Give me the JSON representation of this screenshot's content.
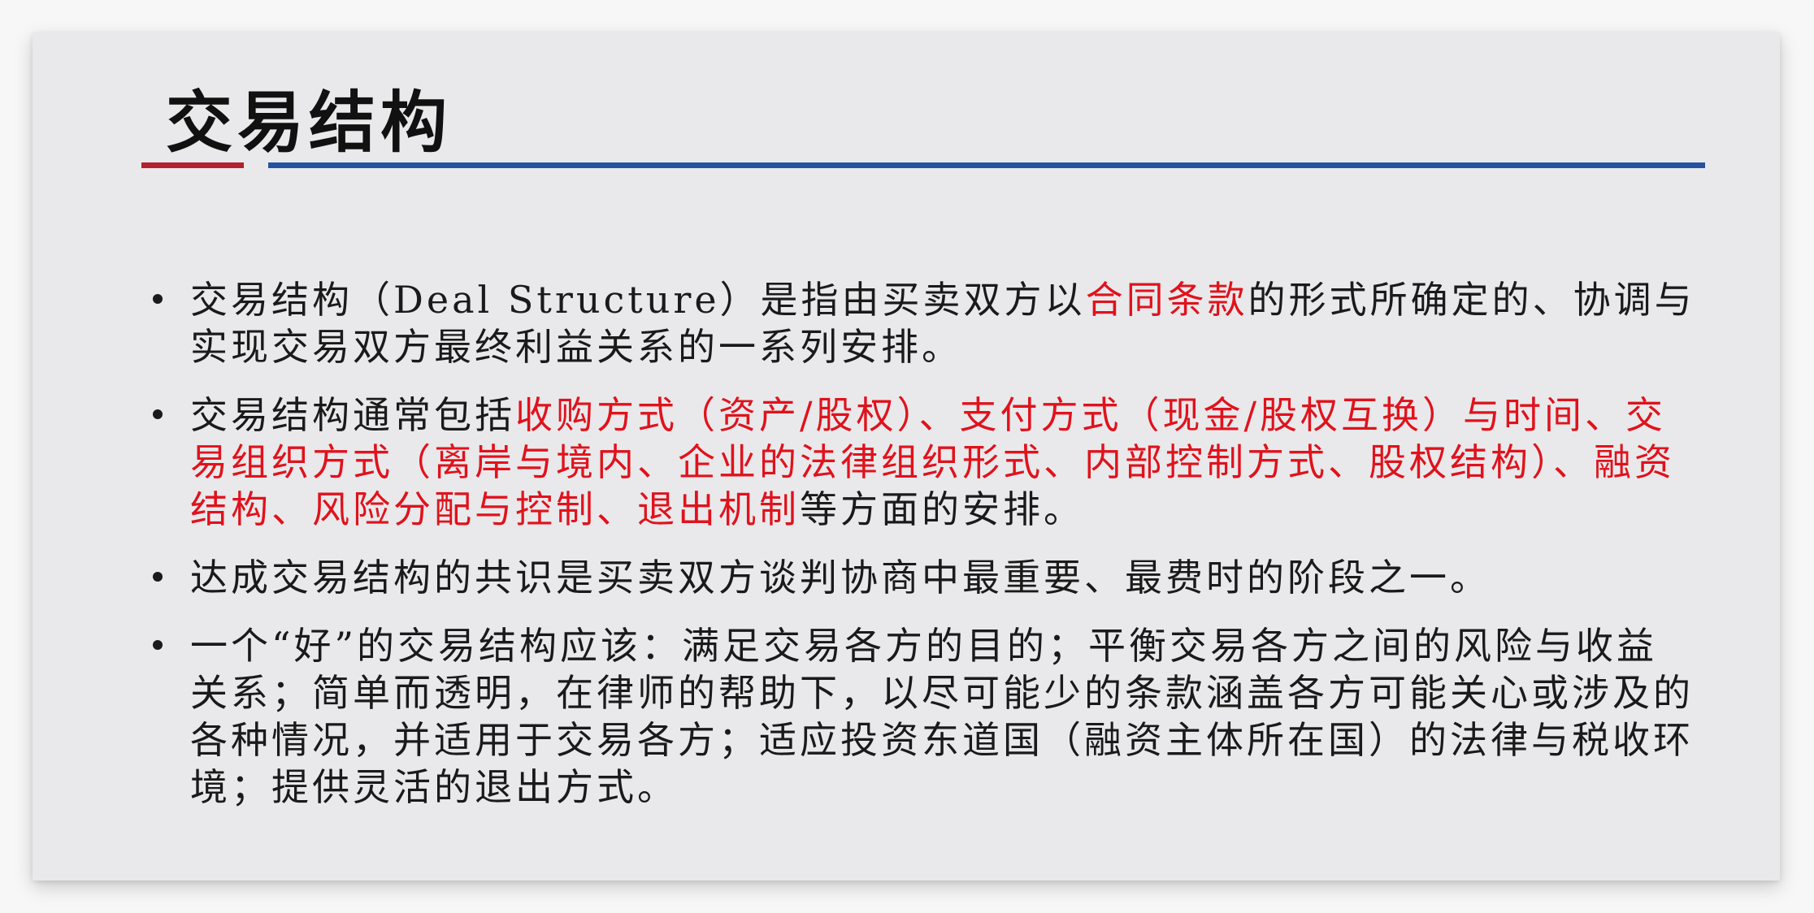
{
  "slide": {
    "title": "交易结构",
    "accent_colors": {
      "title_rule_left": "#b4202d",
      "title_rule_right": "#2652a0",
      "highlight_text": "#e0121c"
    },
    "bullets": [
      {
        "pre": "交易结构（Deal Structure）是指由买卖双方以",
        "highlight": "合同条款",
        "post": "的形式所确定的、协调与实现交易双方最终利益关系的一系列安排。"
      },
      {
        "pre": "交易结构通常包括",
        "highlight": "收购方式（资产/股权）、支付方式（现金/股权互换）与时间、交易组织方式（离岸与境内、企业的法律组织形式、内部控制方式、股权结构）、融资结构、风险分配与控制、退出机制",
        "post": "等方面的安排。"
      },
      {
        "pre": "达成交易结构的共识是买卖双方谈判协商中最重要、最费时的阶段之一。",
        "highlight": "",
        "post": ""
      },
      {
        "pre": "一个“好”的交易结构应该：满足交易各方的目的；平衡交易各方之间的风险与收益关系；简单而透明，在律师的帮助下，以尽可能少的条款涵盖各方可能关心或涉及的各种情况，并适用于交易各方；适应投资东道国（融资主体所在国）的法律与税收环境；提供灵活的退出方式。",
        "highlight": "",
        "post": ""
      }
    ]
  }
}
